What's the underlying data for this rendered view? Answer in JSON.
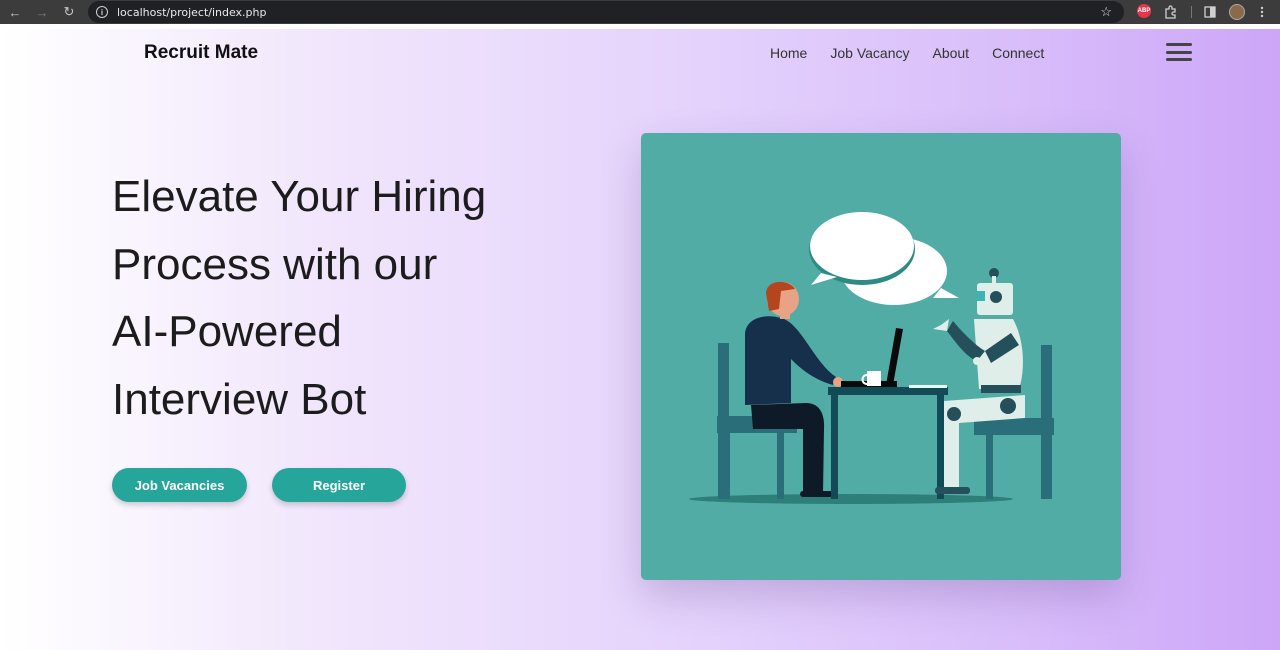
{
  "browser": {
    "url": "localhost/project/index.php",
    "back_icon": "←",
    "forward_icon": "→",
    "reload_icon": "↻",
    "star_icon": "☆",
    "abp_label": "ABP"
  },
  "navbar": {
    "brand": "Recruit Mate",
    "links": [
      "Home",
      "Job Vacancy",
      "About",
      "Connect"
    ]
  },
  "hero": {
    "title_lines": [
      "Elevate Your Hiring",
      "Process with our",
      "AI-Powered",
      "Interview Bot"
    ],
    "primary_button": "Job Vacancies",
    "secondary_button": "Register"
  },
  "colors": {
    "accent": "#26a69a",
    "illustration_bg": "#52aca6"
  }
}
